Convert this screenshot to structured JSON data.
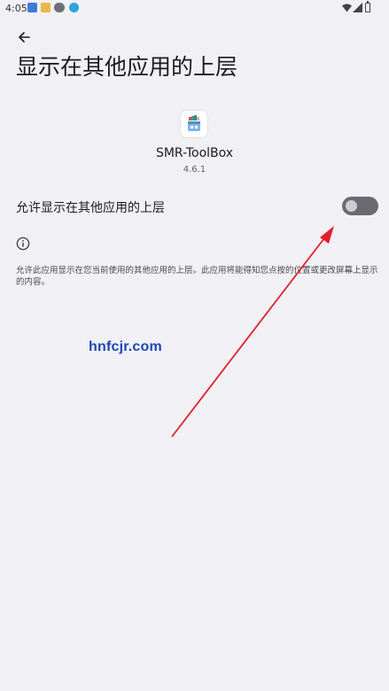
{
  "status_bar": {
    "time": "4:05"
  },
  "header": {
    "back_icon": "arrow-back-icon",
    "title": "显示在其他应用的上层"
  },
  "app": {
    "name": "SMR-ToolBox",
    "version": "4.6.1"
  },
  "permission": {
    "label": "允许显示在其他应用的上层",
    "enabled": false
  },
  "info": {
    "icon": "info-icon",
    "description": "允许此应用显示在您当前使用的其他应用的上层。此应用将能得知您点按的位置或更改屏幕上显示的内容。"
  },
  "watermark": {
    "text": "hnfcjr.com"
  },
  "colors": {
    "background": "#f1f0f5",
    "toggle_track": "#6b6a70",
    "toggle_thumb": "#cfcdd4",
    "watermark": "#1a47b5",
    "annotation_arrow": "#e0202a"
  }
}
